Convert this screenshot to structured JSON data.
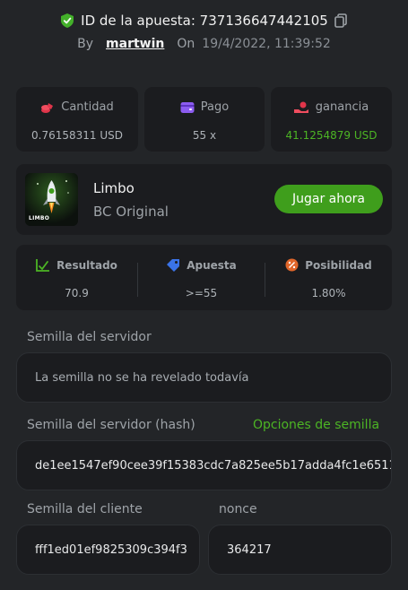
{
  "header": {
    "bet_id_label": "ID de la apuesta: 737136647442105",
    "by_label": "By",
    "username": "martwin",
    "on_label": "On",
    "date": "19/4/2022, 11:39:52"
  },
  "stats": {
    "amount_label": "Cantidad",
    "amount_value": "0.76158311 USD",
    "payout_label": "Pago",
    "payout_value": "55 x",
    "profit_label": "ganancia",
    "profit_value": "41.1254879 USD"
  },
  "game": {
    "name": "Limbo",
    "subtitle": "BC Original",
    "thumb_text": "LIMBO",
    "play_button": "Jugar ahora"
  },
  "result": {
    "result_label": "Resultado",
    "result_value": "70.9",
    "bet_label": "Apuesta",
    "bet_value": ">=55",
    "chance_label": "Posibilidad",
    "chance_value": "1.80%"
  },
  "seeds": {
    "server_seed_label": "Semilla del servidor",
    "server_seed_value": "La semilla no se ha revelado todavía",
    "server_hash_label": "Semilla del servidor (hash)",
    "seed_options_link": "Opciones de semilla",
    "server_hash_value": "de1ee1547ef90cee39f15383cdc7a825ee5b17adda4fc1e6511",
    "client_seed_label": "Semilla del cliente",
    "client_seed_value": "fff1ed01ef9825309c394f3",
    "nonce_label": "nonce",
    "nonce_value": "364217"
  },
  "colors": {
    "accent_green": "#4cb524",
    "button_green": "#3f9e1c",
    "background": "#232528",
    "card": "#1b1c1f"
  },
  "icons": {
    "bet_id": "shield-check-icon",
    "copy": "copy-icon",
    "amount": "coins-icon",
    "payout": "wallet-icon",
    "profit": "hand-coin-icon",
    "result": "chart-check-icon",
    "bet": "tag-icon",
    "chance": "percent-icon"
  }
}
